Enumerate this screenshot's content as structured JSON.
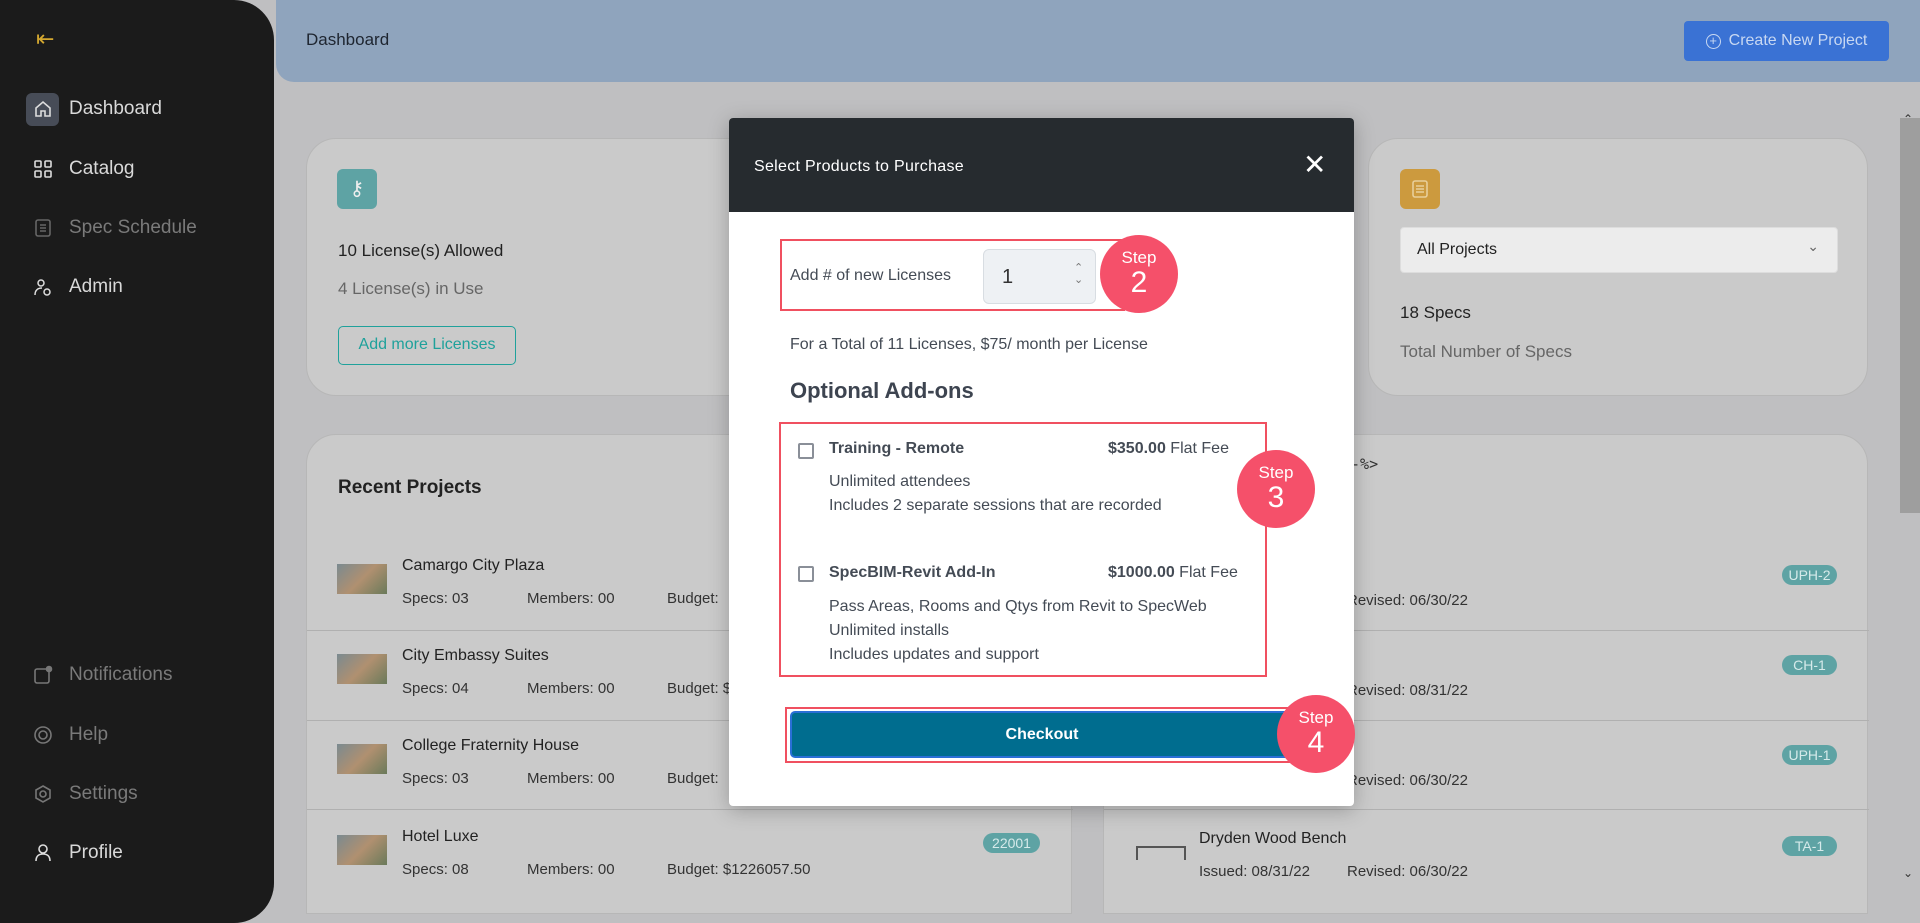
{
  "sidebar": {
    "items": [
      {
        "label": "Dashboard",
        "icon": "home-icon",
        "active": true
      },
      {
        "label": "Catalog",
        "icon": "grid-icon"
      },
      {
        "label": "Spec Schedule",
        "icon": "document-icon",
        "disabled": true
      },
      {
        "label": "Admin",
        "icon": "user-gear-icon"
      },
      {
        "label": "Notifications",
        "icon": "notification-icon",
        "disabled": true
      },
      {
        "label": "Help",
        "icon": "lifebuoy-icon",
        "disabled": true
      },
      {
        "label": "Settings",
        "icon": "gear-icon",
        "disabled": true
      },
      {
        "label": "Profile",
        "icon": "user-icon"
      }
    ]
  },
  "header": {
    "title": "Dashboard",
    "create_button": "Create New Project"
  },
  "license_card": {
    "allowed": "10 License(s) Allowed",
    "in_use": "4 License(s) in Use",
    "add_button": "Add more Licenses"
  },
  "specs_card": {
    "select_value": "All Projects",
    "count": "18 Specs",
    "label": "Total Number of Specs"
  },
  "recent_projects": {
    "title": "Recent Projects",
    "rows": [
      {
        "name": "Camargo City Plaza",
        "specs": "Specs: 03",
        "members": "Members: 00",
        "budget": "Budget: "
      },
      {
        "name": "City Embassy Suites",
        "specs": "Specs: 04",
        "members": "Members: 00",
        "budget": "Budget: $"
      },
      {
        "name": "College Fraternity House",
        "specs": "Specs: 03",
        "members": "Members: 00",
        "budget": "Budget: "
      },
      {
        "name": "Hotel Luxe",
        "specs": "Specs: 08",
        "members": "Members: 00",
        "budget": "Budget: $1226057.50",
        "badge": "22001"
      }
    ]
  },
  "recent_specs": {
    "stray_text": "--%>",
    "rows": [
      {
        "revised": "Revised: 06/30/22",
        "badge": "UPH-2"
      },
      {
        "revised": "Revised: 08/31/22",
        "badge": "CH-1"
      },
      {
        "revised": "Revised: 06/30/22",
        "badge": "UPH-1"
      },
      {
        "name": "Dryden Wood Bench",
        "issued": "Issued: 08/31/22",
        "revised": "Revised: 06/30/22",
        "badge": "TA-1"
      }
    ]
  },
  "modal": {
    "title": "Select Products to Purchase",
    "licenses_label": "Add # of new Licenses",
    "licenses_value": "1",
    "total_text": "For a Total of 11 Licenses, $75/ month per License",
    "addons_title": "Optional Add-ons",
    "addons": [
      {
        "name": "Training - Remote",
        "price": "$350.00",
        "fee": " Flat Fee",
        "checked": false,
        "lines": [
          "Unlimited attendees",
          "Includes 2 separate sessions that are recorded"
        ]
      },
      {
        "name": "SpecBIM-Revit Add-In",
        "price": "$1000.00",
        "fee": " Flat Fee",
        "checked": false,
        "lines": [
          "Pass Areas, Rooms and Qtys from Revit to SpecWeb",
          "Unlimited installs",
          "Includes updates and support"
        ]
      }
    ],
    "checkout": "Checkout",
    "steps": [
      {
        "word": "Step",
        "num": "2"
      },
      {
        "word": "Step",
        "num": "3"
      },
      {
        "word": "Step",
        "num": "4"
      }
    ]
  },
  "colors": {
    "accent": "#006d8f",
    "step": "#f5506a",
    "teal": "#5ea3a4"
  }
}
